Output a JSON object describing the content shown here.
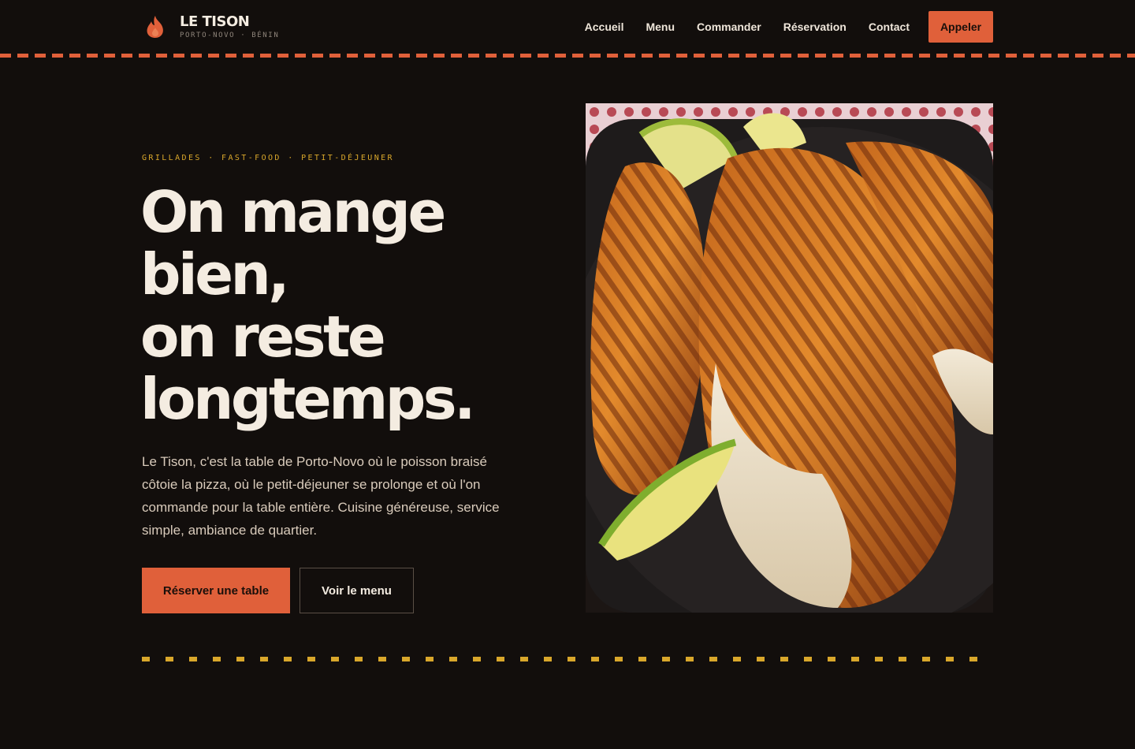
{
  "brand": {
    "name": "LE TISON",
    "location": "PORTO-NOVO · BÉNIN",
    "icon": "flame-icon",
    "accent": "#e0603a"
  },
  "nav": {
    "items": [
      {
        "label": "Accueil"
      },
      {
        "label": "Menu"
      },
      {
        "label": "Commander"
      },
      {
        "label": "Réservation"
      },
      {
        "label": "Contact"
      }
    ],
    "call_label": "Appeler"
  },
  "hero": {
    "eyebrow": "GRILLADES · FAST-FOOD · PETIT-DÉJEUNER",
    "headline_lines": [
      "On mange",
      "bien,",
      "on reste",
      "longtemps."
    ],
    "lead": "Le Tison, c'est la table de Porto-Novo où le poisson braisé côtoie la pizza, où le petit-déjeuner se prolonge et où l'on commande pour la table entière. Cuisine généreuse, service simple, ambiance de quartier.",
    "primary_cta": "Réserver une table",
    "secondary_cta": "Voir le menu"
  },
  "colors": {
    "background": "#120e0c",
    "accent_orange": "#e0603a",
    "accent_yellow": "#d9a72b",
    "text": "#f4ece1"
  }
}
